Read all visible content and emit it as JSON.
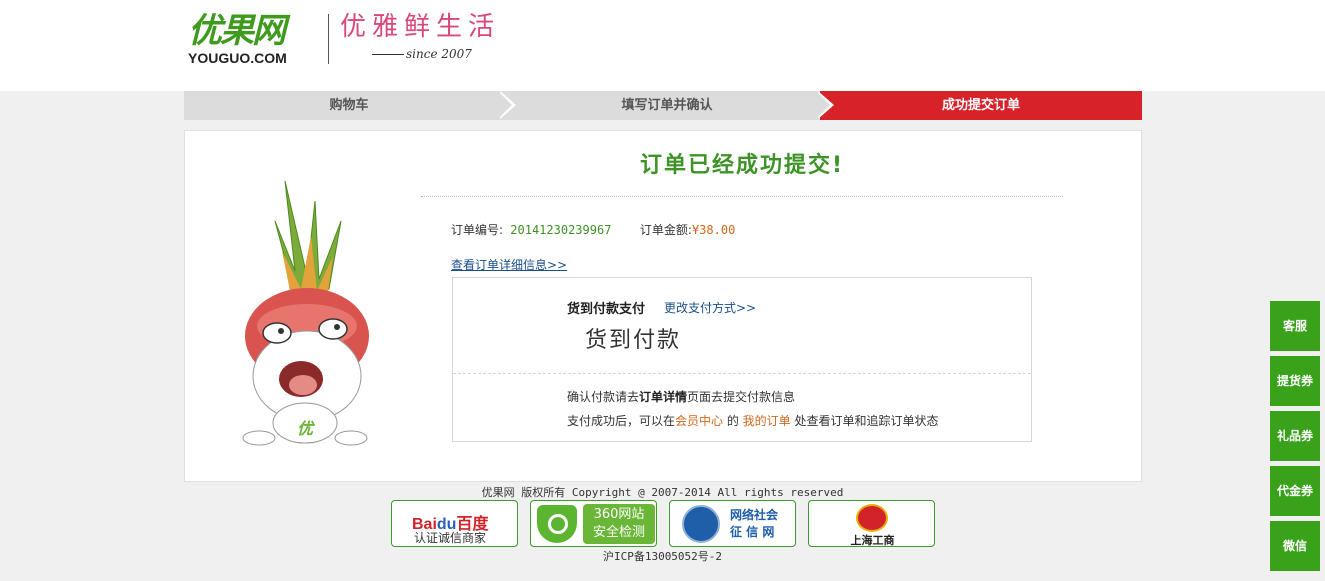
{
  "header": {
    "logo_cn": "优果网",
    "logo_en": "YOUGUO.COM",
    "slogan": "优雅鲜生活",
    "since": "since 2007"
  },
  "steps": [
    {
      "label": "购物车",
      "active": false
    },
    {
      "label": "填写订单并确认",
      "active": false
    },
    {
      "label": "成功提交订单",
      "active": true
    }
  ],
  "order": {
    "success_title": "订单已经成功提交!",
    "number_label": "订单编号:",
    "number_value": "20141230239967",
    "amount_label": "订单金额:",
    "amount_value": "¥38.00",
    "detail_link": "查看订单详细信息>>",
    "pay_method_label": "货到付款支付",
    "change_pay_link": "更改支付方式>>",
    "pay_method_big": "货到付款",
    "confirm_prefix": "确认付款请去",
    "confirm_bold": "订单详情",
    "confirm_suffix": "页面去提交付款信息",
    "after_prefix": "支付成功后，可以在",
    "member_center": "会员中心",
    "after_mid": " 的 ",
    "my_orders": "我的订单",
    "after_suffix": " 处查看订单和追踪订单状态"
  },
  "mascot_label": "优",
  "footer": {
    "copyright": "优果网 版权所有 Copyright @ 2007-2014 All rights reserved",
    "badges": {
      "baidu_logo_a": "Bai",
      "baidu_logo_b": "du",
      "baidu_logo_c": "百度",
      "baidu_text": "认证诚信商家",
      "site360_line1": "360网站",
      "site360_line2": "安全检测",
      "social_line1": "网络社会",
      "social_line2": "征 信 网",
      "shanghai": "上海工商"
    },
    "icp": "沪ICP备13005052号-2"
  },
  "sidebar": [
    "客服",
    "提货券",
    "礼品券",
    "代金券",
    "微信"
  ],
  "colors": {
    "brand_green": "#3e9b1e",
    "active_step_red": "#d72229",
    "sidebar_green": "#39a21a",
    "link_blue": "#1a4f8b",
    "accent_orange": "#d2691e"
  }
}
